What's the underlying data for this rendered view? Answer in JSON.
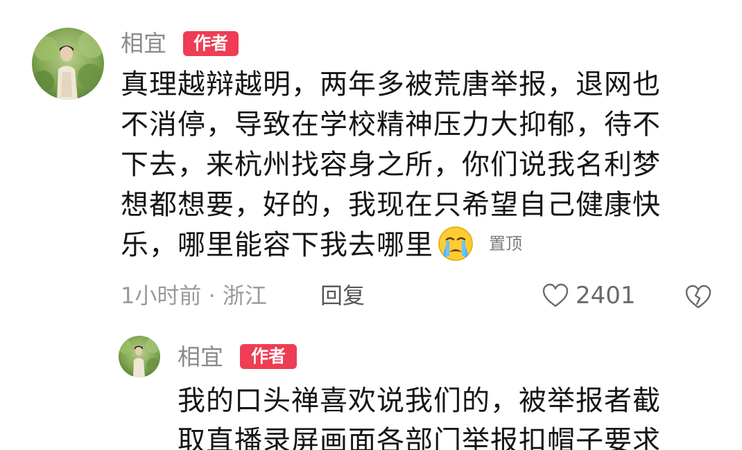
{
  "main_comment": {
    "username": "相宜",
    "badge": "作者",
    "lines": [
      "真理越辩越明，两年多被荒唐举报，退网也",
      "不消停，导致在学校精神压力大抑郁，待不",
      "下去，来杭州找容身之所，你们说我名利梦",
      "想都想要，好的，我现在只希望自己健康快",
      "乐，哪里能容下我去哪里"
    ],
    "emoji": "crying-face-emoji",
    "pinned_label": "置顶",
    "time_location": "1小时前 · 浙江",
    "reply_label": "回复",
    "like_count": "2401"
  },
  "reply_comment": {
    "username": "相宜",
    "badge": "作者",
    "lines": [
      "我的口头禅喜欢说我们的，被举报者截",
      "取直播录屏画面各部门举报扣帽子要求"
    ]
  },
  "colors": {
    "badge": "#ee3d54",
    "username": "#8a8a8a",
    "meta": "#9a9a9a"
  }
}
